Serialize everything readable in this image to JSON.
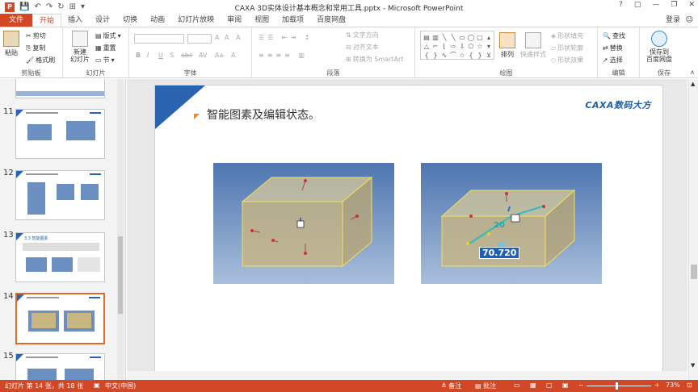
{
  "window": {
    "title": "CAXA 3D实体设计基本概念和常用工具.pptx - Microsoft PowerPoint",
    "controls": [
      "?",
      "▢",
      "—",
      "❐",
      "✕"
    ]
  },
  "qat": {
    "save": "💾",
    "undo": "↶",
    "redo": "↷",
    "repeat": "↻",
    "more": "⊞",
    "customize": "▾"
  },
  "tabs": [
    "文件",
    "开始",
    "插入",
    "设计",
    "切换",
    "动画",
    "幻灯片放映",
    "审阅",
    "视图",
    "加载项",
    "百度网盘"
  ],
  "login": "登录",
  "ribbon": {
    "clipboard": {
      "label": "剪贴板",
      "paste": "粘贴",
      "cut": "剪切",
      "copy": "复制",
      "format_painter": "格式刷"
    },
    "slides": {
      "label": "幻灯片",
      "new_slide": "新建\n幻灯片",
      "layout": "版式",
      "reset": "重置",
      "section": "节"
    },
    "font": {
      "label": "字体",
      "bold": "B",
      "italic": "I",
      "underline": "U",
      "shadow": "S",
      "strike": "abc",
      "spacing": "AV",
      "case": "Aa",
      "color": "A",
      "grow": "A",
      "shrink": "A",
      "clear": "A"
    },
    "paragraph": {
      "label": "段落",
      "text_direction": "文字方向",
      "align_text": "对齐文本",
      "smartart": "转换为 SmartArt"
    },
    "drawing": {
      "label": "绘图",
      "arrange": "排列",
      "quick_styles": "快速样式",
      "fill": "形状填充",
      "outline": "形状轮廓",
      "effects": "形状效果"
    },
    "editing": {
      "label": "编辑",
      "find": "查找",
      "replace": "替换",
      "select": "选择"
    },
    "save_group": {
      "label": "保存",
      "save_to_baidu": "保存到\n百度网盘"
    }
  },
  "slide_panel": {
    "items": [
      {
        "num": "",
        "selected": false
      },
      {
        "num": "11",
        "selected": false
      },
      {
        "num": "12",
        "selected": false
      },
      {
        "num": "13",
        "selected": false,
        "heading": "3.3 智能图素"
      },
      {
        "num": "14",
        "selected": true
      },
      {
        "num": "15",
        "selected": false
      }
    ]
  },
  "slide": {
    "title": "智能图素及编辑状态。",
    "brand": "CAXA数码大方",
    "measure_value": "70.720",
    "dim_label": "20"
  },
  "status": {
    "slide_info": "幻灯片 第 14 张，共 18 张",
    "language": "中文(中国)",
    "notes": "备注",
    "comments": "批注",
    "zoom": "73%"
  },
  "colors": {
    "accent": "#d24726",
    "brand_blue": "#1d5fab",
    "box": "#c7b582"
  }
}
